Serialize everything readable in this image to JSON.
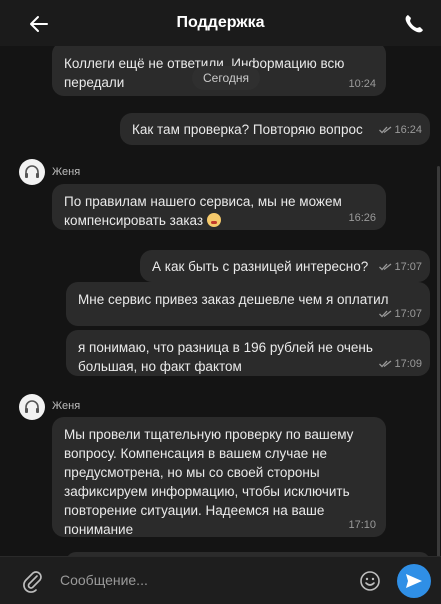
{
  "header": {
    "title": "Поддержка",
    "back_icon": "arrow-left-icon",
    "call_icon": "phone-icon"
  },
  "chat": {
    "date_chip": "Сегодня",
    "messages": [
      {
        "text": "Коллеги ещё не ответили. Информацию всю передали",
        "time": "10:24"
      },
      {
        "text": "Как там проверка? Повторяю вопрос",
        "time": "16:24"
      },
      {
        "sender": "Женя",
        "text": "По правилам нашего сервиса, мы не можем компенсировать заказ",
        "time": "16:26"
      },
      {
        "text": "А как быть с разницей интересно?",
        "time": "17:07"
      },
      {
        "text": "Мне сервис привез заказ дешевле чем я оплатил",
        "time": "17:07"
      },
      {
        "text": "я понимаю, что разница в 196 рублей не очень большая, но факт фактом",
        "time": "17:09"
      },
      {
        "sender": "Женя",
        "text": "Мы провели тщательную проверку по вашему вопросу. Компенсация в вашем случае не предусмотрена, но мы со своей стороны зафиксируем информацию, чтобы исключить повторение ситуации. Надеемся на ваше понимание",
        "time": "17:10"
      }
    ]
  },
  "composer": {
    "placeholder": "Сообщение...",
    "attach_icon": "paperclip-icon",
    "emoji_icon": "smiley-icon",
    "send_icon": "send-icon"
  },
  "colors": {
    "background": "#141414",
    "bubble": "#2b2b2b",
    "accent": "#2f8fe6"
  }
}
